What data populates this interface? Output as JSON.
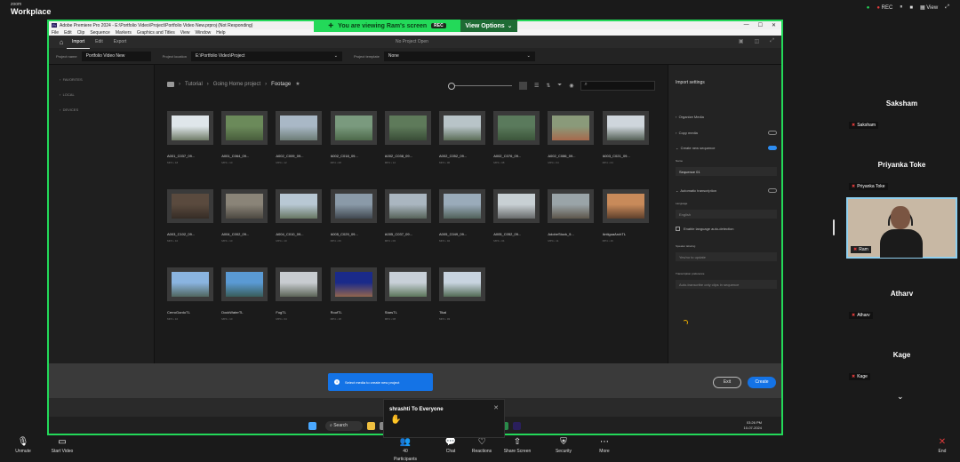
{
  "zoom": {
    "brand_top": "zoom",
    "brand": "Workplace",
    "rec": "REC",
    "view": "View",
    "banner": {
      "text": "You are viewing  Ram's screen",
      "rec": "REC",
      "options": "View Options"
    }
  },
  "window": {
    "title": "Adobe Premiere Pro 2024 - E:\\Portfolio Video\\Project\\Portfolio Video New.prproj (Not Responding)",
    "menu": [
      "File",
      "Edit",
      "Clip",
      "Sequence",
      "Markers",
      "Graphics and Titles",
      "View",
      "Window",
      "Help"
    ]
  },
  "app": {
    "tabs": [
      "Import",
      "Edit",
      "Export"
    ],
    "center_title": "No Project Open"
  },
  "project": {
    "name_label": "Project name",
    "name": "Portfolio Video New",
    "location_label": "Project location",
    "location": "E:\\Portfolio Video\\Project",
    "template_label": "Project template",
    "template": "None"
  },
  "left_nav": [
    "FAVORITES",
    "LOCAL",
    "DEVICES"
  ],
  "breadcrumb": [
    "Tutorial",
    "Going Home project",
    "Footage"
  ],
  "media": [
    {
      "name": "A001_C037_09...",
      "meta": "MP4 • 18",
      "c1": "#dfe6ea",
      "c2": "#4c5a3e"
    },
    {
      "name": "A001_C064_09...",
      "meta": "MP4 • 10",
      "c1": "#6b8a5a",
      "c2": "#3d4f33"
    },
    {
      "name": "A002_C009_09...",
      "meta": "MP4 • 12",
      "c1": "#a9b8c6",
      "c2": "#5a6a5e"
    },
    {
      "name": "A002_C018_09...",
      "meta": "MP4 • 08",
      "c1": "#7a9a7e",
      "c2": "#3f5a3a"
    },
    {
      "name": "A002_C038_09...",
      "meta": "MP4 • 12",
      "c1": "#5e7a5a",
      "c2": "#2e3f2c"
    },
    {
      "name": "A002_C052_09...",
      "meta": "MP4 • 06",
      "c1": "#b8c4c8",
      "c2": "#3e5234"
    },
    {
      "name": "A002_C076_09...",
      "meta": "MP4 • 08",
      "c1": "#5a7a5c",
      "c2": "#334a30"
    },
    {
      "name": "A002_C086_09...",
      "meta": "MP4 • 04",
      "c1": "#8a9a7a",
      "c2": "#b05a3e"
    },
    {
      "name": "A003_C021_09...",
      "meta": "MP4 • 04",
      "c1": "#cfd6dc",
      "c2": "#2d3a2b"
    },
    {
      "name": "A003_C102_09...",
      "meta": "MP4 • 10",
      "c1": "#5a4a3e",
      "c2": "#2a231e"
    },
    {
      "name": "A004_C002_09...",
      "meta": "MP4 • 10",
      "c1": "#8a8478",
      "c2": "#3a3630"
    },
    {
      "name": "A004_C010_09...",
      "meta": "MP4 • 10",
      "c1": "#b8c8d4",
      "c2": "#4e5e3e"
    },
    {
      "name": "A005_C029_09...",
      "meta": "MP4 • 06",
      "c1": "#8a9aa8",
      "c2": "#2a2f35"
    },
    {
      "name": "A005_C037_09...",
      "meta": "MP4 • 06",
      "c1": "#aab6c0",
      "c2": "#3e4a3a"
    },
    {
      "name": "A005_C049_09...",
      "meta": "MP4 • 04",
      "c1": "#9aabba",
      "c2": "#3a4a3c"
    },
    {
      "name": "A005_C052_09...",
      "meta": "MP4 • 04",
      "c1": "#c8d0d4",
      "c2": "#4a4a4a"
    },
    {
      "name": "AdobeStock_9...",
      "meta": "MP4 • 11",
      "c1": "#9aa4a8",
      "c2": "#4a3e2e"
    },
    {
      "name": "AntiguaArchTL",
      "meta": "MP4 • 16",
      "c1": "#c88a5a",
      "c2": "#3e2a1e"
    },
    {
      "name": "CerroGordoTL",
      "meta": "MP4 • 10",
      "c1": "#8ab4e0",
      "c2": "#3e4e38"
    },
    {
      "name": "DockWaterTL",
      "meta": "MP4 • 10",
      "c1": "#5a9ad4",
      "c2": "#2e4a34"
    },
    {
      "name": "FogTL",
      "meta": "MP4 • 34",
      "c1": "#c8ccd0",
      "c2": "#3a4432"
    },
    {
      "name": "RoofTL",
      "meta": "MP4 • 18",
      "c1": "#1a2a8a",
      "c2": "#b8783a"
    },
    {
      "name": "StarsTL",
      "meta": "MP4 • 08",
      "c1": "#c8d0d8",
      "c2": "#3a5a34"
    },
    {
      "name": "Tikal",
      "meta": "MP4 • 03",
      "c1": "#c8d4e0",
      "c2": "#2e4a2a"
    }
  ],
  "import": {
    "title": "Import settings",
    "organize": "Organize Media",
    "copy": "Copy media",
    "create_seq": "Create new sequence",
    "name_label": "Name",
    "seq_name": "Sequence 01",
    "auto_trans": "Automatic transcription",
    "lang_label": "Language",
    "lang": "English",
    "lang_detect": "Enable language auto-detection",
    "speaker_label": "Speaker labeling",
    "speaker": "Yes/no to update",
    "pref_label": "Transcription preference",
    "pref": "Auto-transcribe only clips in sequence"
  },
  "bottom": {
    "toast": "Select media to create new project",
    "exit": "Exit",
    "create": "Create"
  },
  "taskbar": {
    "search": "Search",
    "time": "03:26 PM",
    "date": "10-07-2024"
  },
  "chat": {
    "title": "shrashti To Everyone",
    "close": "✕"
  },
  "participants": [
    {
      "name": "Saksham",
      "label": "Saksham"
    },
    {
      "name": "Priyanka Toke",
      "label": "Priyanka Toke"
    },
    {
      "name": "",
      "label": "Ram"
    },
    {
      "name": "Atharv",
      "label": "Atharv"
    },
    {
      "name": "Kage",
      "label": "Kage"
    }
  ],
  "toolbar": [
    {
      "label": "Unmute",
      "icon": "🎙"
    },
    {
      "label": "Start Video",
      "icon": "▭"
    },
    {
      "label": "Participants",
      "icon": "👥",
      "count": "40"
    },
    {
      "label": "Chat",
      "icon": "💬"
    },
    {
      "label": "Reactions",
      "icon": "♡"
    },
    {
      "label": "Share Screen",
      "icon": "⇧"
    },
    {
      "label": "Security",
      "icon": "⛨"
    },
    {
      "label": "More",
      "icon": "⋯"
    },
    {
      "label": "End",
      "icon": "✕"
    }
  ]
}
